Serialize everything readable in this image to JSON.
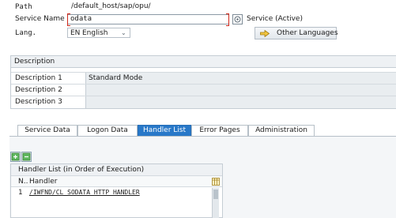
{
  "form": {
    "path_label": "Path",
    "path_value": "/default_host/sap/opu/",
    "service_name_label": "Service Name",
    "service_name_value": "odata",
    "service_status": "Service (Active)",
    "lang_label": "Lang.",
    "lang_code": "EN",
    "lang_name": "English",
    "other_languages_label": "Other Languages"
  },
  "description": {
    "header": "Description",
    "rows": [
      {
        "label": "Description 1",
        "value": "Standard Mode"
      },
      {
        "label": "Description 2",
        "value": ""
      },
      {
        "label": "Description 3",
        "value": ""
      }
    ]
  },
  "tabs": [
    {
      "label": "Service Data",
      "active": false
    },
    {
      "label": "Logon Data",
      "active": false
    },
    {
      "label": "Handler List",
      "active": true
    },
    {
      "label": "Error Pages",
      "active": false
    },
    {
      "label": "Administration",
      "active": false
    }
  ],
  "handler_list": {
    "title": "Handler List (in Order of Execution)",
    "col_n": "N..",
    "col_handler": "Handler",
    "rows": [
      {
        "n": "1",
        "handler": "/IWFND/CL_SODATA_HTTP_HANDLER"
      }
    ]
  },
  "icons": {
    "service_status": "service-status-icon",
    "other_languages": "arrow-right-icon",
    "insert_row": "insert-row-icon",
    "delete_row": "delete-row-icon",
    "column_settings": "column-settings-icon"
  },
  "colors": {
    "active_tab": "#2878c8",
    "required_marker": "#d0281a",
    "field_bg": "#e9edf0"
  }
}
